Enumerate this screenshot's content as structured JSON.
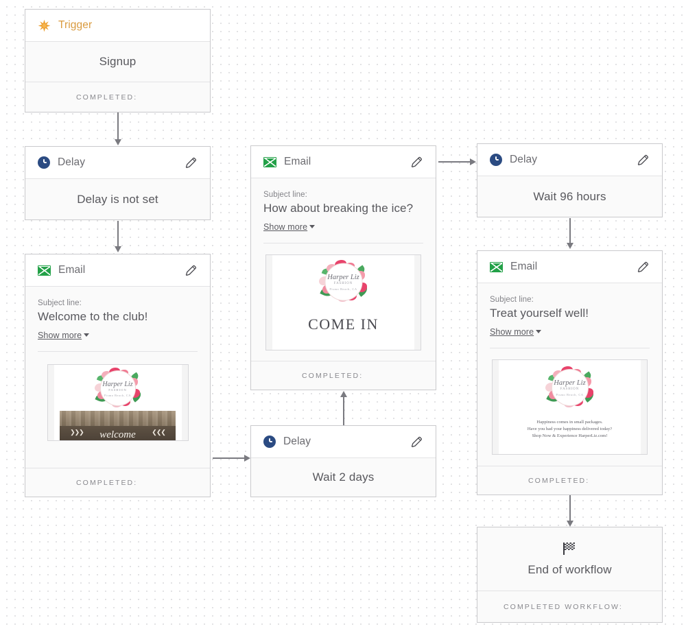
{
  "nodes": {
    "trigger": {
      "type_label": "Trigger",
      "icon": "starburst-icon",
      "body_label": "Signup",
      "footer_label": "COMPLETED:"
    },
    "delay1": {
      "type_label": "Delay",
      "icon": "clock-icon",
      "edit_icon": "pencil-icon",
      "body_label": "Delay is not set"
    },
    "email1": {
      "type_label": "Email",
      "icon": "envelope-icon",
      "edit_icon": "pencil-icon",
      "subject_label": "Subject line:",
      "subject_value": "Welcome to the club!",
      "show_more": "Show more",
      "footer_label": "COMPLETED:",
      "preview": {
        "logo_name": "Harper Liz",
        "logo_sub": "FASHION",
        "logo_loc": "Pismo Beach, CA",
        "banner_text": "welcome"
      }
    },
    "email2": {
      "type_label": "Email",
      "icon": "envelope-icon",
      "edit_icon": "pencil-icon",
      "subject_label": "Subject line:",
      "subject_value": "How about breaking the ice?",
      "show_more": "Show more",
      "footer_label": "COMPLETED:",
      "preview": {
        "logo_name": "Harper Liz",
        "logo_sub": "FASHION",
        "logo_loc": "Pismo Beach, CA",
        "banner_text": "COME IN"
      }
    },
    "delay2": {
      "type_label": "Delay",
      "icon": "clock-icon",
      "edit_icon": "pencil-icon",
      "body_label": "Wait 2 days"
    },
    "delay3": {
      "type_label": "Delay",
      "icon": "clock-icon",
      "edit_icon": "pencil-icon",
      "body_label": "Wait 96 hours"
    },
    "email3": {
      "type_label": "Email",
      "icon": "envelope-icon",
      "edit_icon": "pencil-icon",
      "subject_label": "Subject line:",
      "subject_value": "Treat yourself well!",
      "show_more": "Show more",
      "footer_label": "COMPLETED:",
      "preview": {
        "logo_name": "Harper Liz",
        "logo_sub": "FASHION",
        "logo_loc": "Pismo Beach, CA",
        "promo_line1": "Happiness comes in small packages.",
        "promo_line2": "Have you had your happiness delivered today?",
        "promo_line3": "Shop Now & Experience HarperLiz.com!"
      }
    },
    "end": {
      "icon": "checkered-flag-icon",
      "body_label": "End of workflow",
      "footer_label": "COMPLETED WORKFLOW:"
    }
  },
  "colors": {
    "trigger_accent": "#d99b3f",
    "email_accent": "#23a148",
    "delay_accent": "#2b4b82",
    "card_bg": "#fafafa",
    "card_border": "#c9c9cc",
    "connector": "#7a7a80"
  }
}
